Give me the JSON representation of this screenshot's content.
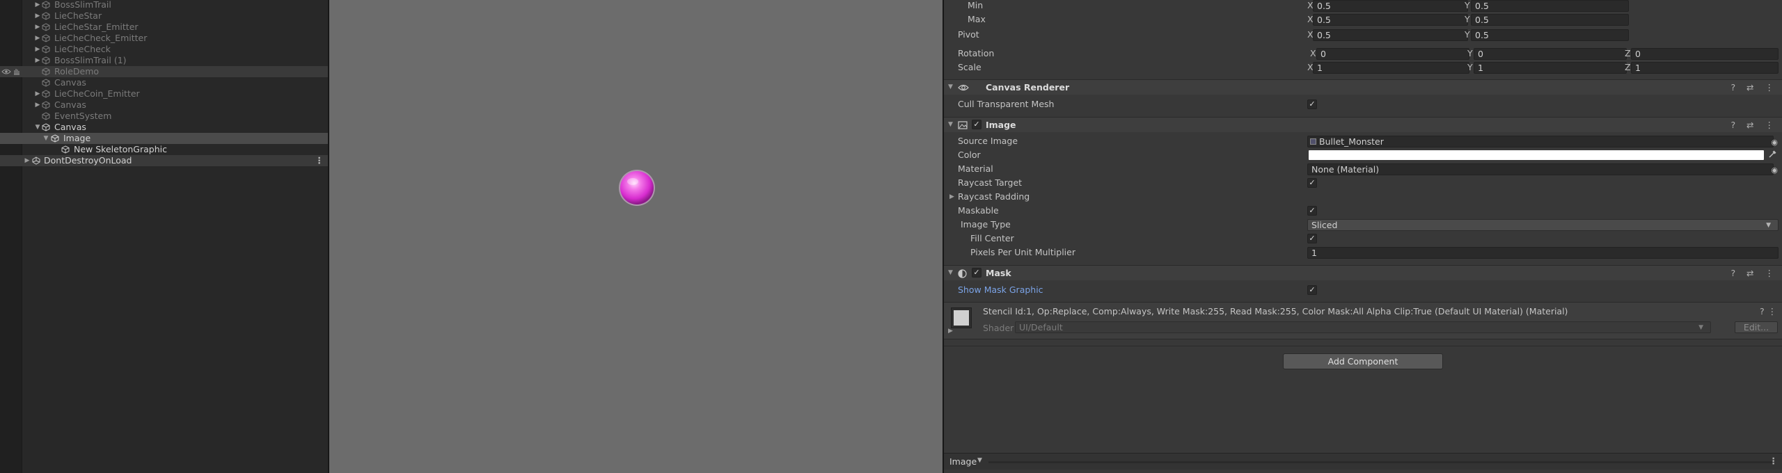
{
  "hierarchy": {
    "items": [
      {
        "label": "BossSlimTrail"
      },
      {
        "label": "LieCheStar"
      },
      {
        "label": "LieCheStar_Emitter"
      },
      {
        "label": "LieCheCheck_Emitter"
      },
      {
        "label": "LieCheCheck"
      },
      {
        "label": "BossSlimTrail (1)"
      },
      {
        "label": "RoleDemo"
      },
      {
        "label": "Canvas"
      },
      {
        "label": "LieCheCoin_Emitter"
      },
      {
        "label": "Canvas"
      },
      {
        "label": "EventSystem"
      },
      {
        "label": "Canvas"
      },
      {
        "label": "Image"
      },
      {
        "label": "New SkeletonGraphic"
      },
      {
        "label": "DontDestroyOnLoad"
      }
    ],
    "kebab": "⋮"
  },
  "scene": {
    "background": "#6c6c6c",
    "orb_color": "#e03cd6"
  },
  "inspector": {
    "anchors": {
      "min_label": "Min",
      "min_x": "0.5",
      "min_y": "0.5",
      "max_label": "Max",
      "max_x": "0.5",
      "max_y": "0.5"
    },
    "pivot": {
      "label": "Pivot",
      "x": "0.5",
      "y": "0.5"
    },
    "rotation": {
      "label": "Rotation",
      "x": "0",
      "y": "0",
      "z": "0"
    },
    "scale": {
      "label": "Scale",
      "x": "1",
      "y": "1",
      "z": "1"
    },
    "axes": {
      "x": "X",
      "y": "Y",
      "z": "Z"
    },
    "canvas_renderer": {
      "title": "Canvas Renderer",
      "cull_label": "Cull Transparent Mesh",
      "cull_checked": "✓"
    },
    "image": {
      "title": "Image",
      "enabled_check": "✓",
      "source_label": "Source Image",
      "source_value": "Bullet_Monster",
      "color_label": "Color",
      "color_value": "#ffffff",
      "material_label": "Material",
      "material_value": "None (Material)",
      "raycast_target_label": "Raycast Target",
      "raycast_target_check": "✓",
      "raycast_padding_label": "Raycast Padding",
      "maskable_label": "Maskable",
      "maskable_check": "✓",
      "image_type_label": "Image Type",
      "image_type_value": "Sliced",
      "fill_center_label": "Fill Center",
      "fill_center_check": "✓",
      "ppu_label": "Pixels Per Unit Multiplier",
      "ppu_value": "1"
    },
    "mask": {
      "title": "Mask",
      "enabled_check": "✓",
      "show_graphic_label": "Show Mask Graphic",
      "show_graphic_check": "✓"
    },
    "material_preview": {
      "desc": "Stencil Id:1, Op:Replace, Comp:Always, Write Mask:255, Read Mask:255, Color Mask:All Alpha Clip:True (Default UI Material) (Material)",
      "shader_label": "Shader",
      "shader_value": "UI/Default",
      "edit_label": "Edit..."
    },
    "add_component_label": "Add Component",
    "footer_label": "Image",
    "header_icons": "? ⇄ ⋮"
  },
  "colors": {
    "link_blue": "#7ba3e6",
    "panel": "#383838",
    "hierarchy": "#282828"
  }
}
